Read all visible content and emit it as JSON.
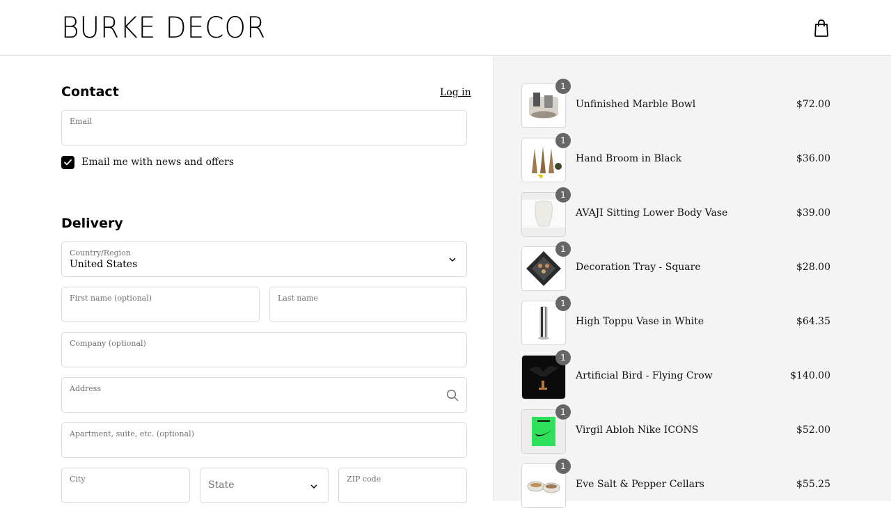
{
  "brand": {
    "logo": "BURKE DECOR"
  },
  "contact": {
    "title": "Contact",
    "login": "Log in",
    "email_label": "Email",
    "newsletter_label": "Email me with news and offers",
    "newsletter_checked": true
  },
  "delivery": {
    "title": "Delivery",
    "country_label": "Country/Region",
    "country_value": "United States",
    "first_name_label": "First name (optional)",
    "last_name_label": "Last name",
    "company_label": "Company (optional)",
    "address_label": "Address",
    "apartment_label": "Apartment, suite, etc. (optional)",
    "city_label": "City",
    "state_placeholder": "State",
    "zip_label": "ZIP code"
  },
  "order": {
    "items": [
      {
        "name": "Unfinished Marble Bowl",
        "price": "$72.00",
        "qty": "1"
      },
      {
        "name": "Hand Broom in Black",
        "price": "$36.00",
        "qty": "1"
      },
      {
        "name": "AVAJI Sitting Lower Body Vase",
        "price": "$39.00",
        "qty": "1"
      },
      {
        "name": "Decoration Tray - Square",
        "price": "$28.00",
        "qty": "1"
      },
      {
        "name": "High Toppu Vase in White",
        "price": "$64.35",
        "qty": "1"
      },
      {
        "name": "Artificial Bird - Flying Crow",
        "price": "$140.00",
        "qty": "1"
      },
      {
        "name": "Virgil Abloh Nike ICONS",
        "price": "$52.00",
        "qty": "1"
      },
      {
        "name": "Eve Salt & Pepper Cellars",
        "price": "$55.25",
        "qty": "1"
      }
    ]
  },
  "icons": {
    "cart": "shopping-bag-icon",
    "checkbox": "checkmark-icon",
    "dropdown": "chevron-down-icon",
    "search": "search-icon"
  }
}
